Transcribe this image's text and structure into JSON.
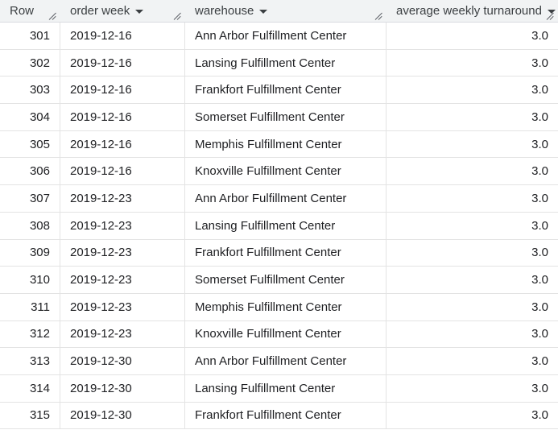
{
  "table": {
    "headers": {
      "row": "Row",
      "order_week": "order week",
      "warehouse": "warehouse",
      "avg_turnaround": "average weekly turnaround"
    },
    "rows": [
      {
        "row": "301",
        "order_week": "2019-12-16",
        "warehouse": "Ann Arbor Fulfillment Center",
        "avg": "3.0"
      },
      {
        "row": "302",
        "order_week": "2019-12-16",
        "warehouse": "Lansing Fulfillment Center",
        "avg": "3.0"
      },
      {
        "row": "303",
        "order_week": "2019-12-16",
        "warehouse": "Frankfort Fulfillment Center",
        "avg": "3.0"
      },
      {
        "row": "304",
        "order_week": "2019-12-16",
        "warehouse": "Somerset Fulfillment Center",
        "avg": "3.0"
      },
      {
        "row": "305",
        "order_week": "2019-12-16",
        "warehouse": "Memphis Fulfillment Center",
        "avg": "3.0"
      },
      {
        "row": "306",
        "order_week": "2019-12-16",
        "warehouse": "Knoxville Fulfillment Center",
        "avg": "3.0"
      },
      {
        "row": "307",
        "order_week": "2019-12-23",
        "warehouse": "Ann Arbor Fulfillment Center",
        "avg": "3.0"
      },
      {
        "row": "308",
        "order_week": "2019-12-23",
        "warehouse": "Lansing Fulfillment Center",
        "avg": "3.0"
      },
      {
        "row": "309",
        "order_week": "2019-12-23",
        "warehouse": "Frankfort Fulfillment Center",
        "avg": "3.0"
      },
      {
        "row": "310",
        "order_week": "2019-12-23",
        "warehouse": "Somerset Fulfillment Center",
        "avg": "3.0"
      },
      {
        "row": "311",
        "order_week": "2019-12-23",
        "warehouse": "Memphis Fulfillment Center",
        "avg": "3.0"
      },
      {
        "row": "312",
        "order_week": "2019-12-23",
        "warehouse": "Knoxville Fulfillment Center",
        "avg": "3.0"
      },
      {
        "row": "313",
        "order_week": "2019-12-30",
        "warehouse": "Ann Arbor Fulfillment Center",
        "avg": "3.0"
      },
      {
        "row": "314",
        "order_week": "2019-12-30",
        "warehouse": "Lansing Fulfillment Center",
        "avg": "3.0"
      },
      {
        "row": "315",
        "order_week": "2019-12-30",
        "warehouse": "Frankfort Fulfillment Center",
        "avg": "3.0"
      }
    ]
  }
}
